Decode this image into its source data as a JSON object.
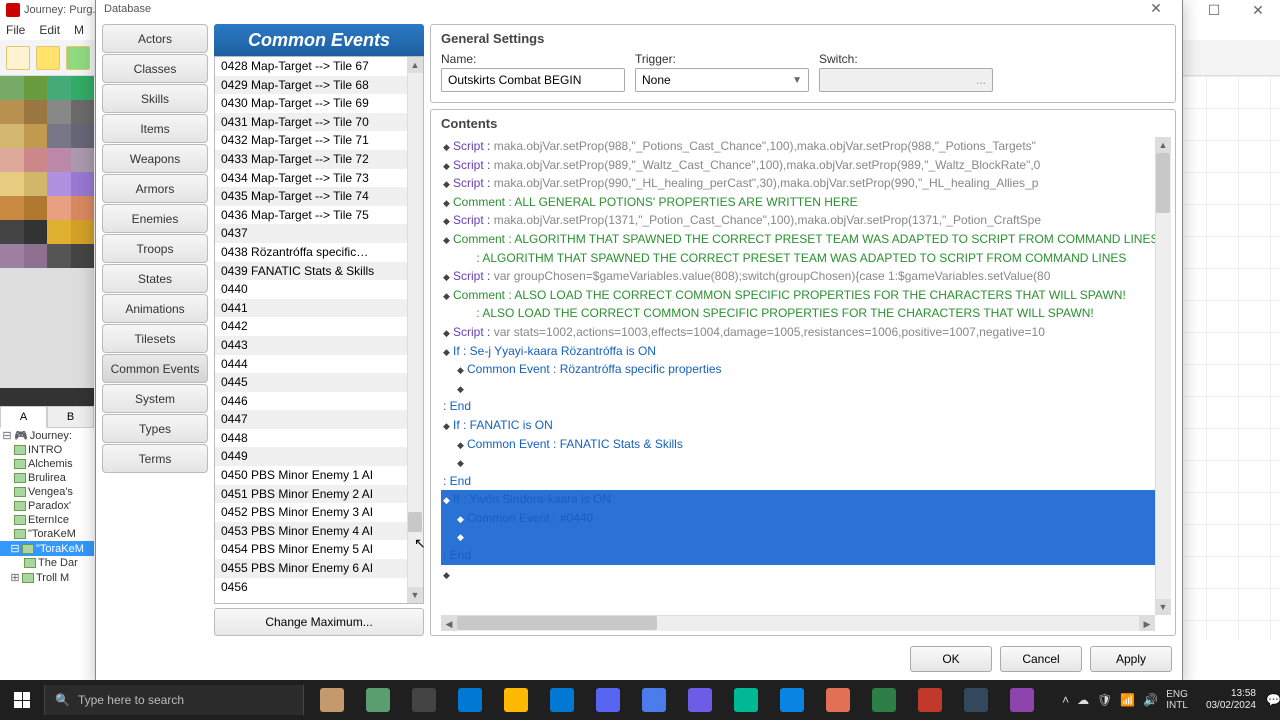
{
  "mainWindow": {
    "title": "Journey: Purg..."
  },
  "menubar": [
    "File",
    "Edit",
    "M"
  ],
  "layerTabs": {
    "a": "A",
    "b": "B"
  },
  "mapTree": {
    "root": "Journey:",
    "items": [
      "INTRO",
      "Alchemis",
      "Brulirea",
      "Vengea's",
      "Paradox'",
      "EternIce",
      "\"ToraKeM",
      "\"ToraKeM",
      "The Dar",
      "Troll M"
    ]
  },
  "dialog": {
    "title": "Database",
    "categories": [
      "Actors",
      "Classes",
      "Skills",
      "Items",
      "Weapons",
      "Armors",
      "Enemies",
      "Troops",
      "States",
      "Animations",
      "Tilesets",
      "Common Events",
      "System",
      "Types",
      "Terms"
    ],
    "activeCategory": "Common Events",
    "listHeader": "Common Events",
    "changeMax": "Change Maximum...",
    "list": [
      "0428 Map-Target --> Tile 67",
      "0429 Map-Target --> Tile 68",
      "0430 Map-Target --> Tile 69",
      "0431 Map-Target --> Tile 70",
      "0432 Map-Target --> Tile 71",
      "0433 Map-Target --> Tile 72",
      "0434 Map-Target --> Tile 73",
      "0435 Map-Target --> Tile 74",
      "0436 Map-Target --> Tile 75",
      "0437",
      "0438 Rözantróffa specific…",
      "0439 FANATIC Stats & Skills",
      "0440",
      "0441",
      "0442",
      "0443",
      "0444",
      "0445",
      "0446",
      "0447",
      "0448",
      "0449",
      "0450 PBS Minor Enemy 1 AI",
      "0451 PBS Minor Enemy 2 AI",
      "0452 PBS Minor Enemy 3 AI",
      "0453 PBS Minor Enemy 4 AI",
      "0454 PBS Minor Enemy 5 AI",
      "0455 PBS Minor Enemy 6 AI",
      "0456"
    ],
    "generalSettings": {
      "title": "General Settings",
      "nameLabel": "Name:",
      "nameValue": "Outskirts Combat BEGIN",
      "triggerLabel": "Trigger:",
      "triggerValue": "None",
      "switchLabel": "Switch:",
      "switchValue": "..."
    },
    "contentsTitle": "Contents",
    "code": [
      {
        "t": "script",
        "pl": "maka.objVar.setProp(988,\"_Potions_Cast_Chance\",100),maka.objVar.setProp(988,\"_Potions_Targets\""
      },
      {
        "t": "script",
        "pl": "maka.objVar.setProp(989,\"_Waltz_Cast_Chance\",100),maka.objVar.setProp(989,\"_Waltz_BlockRate\",0"
      },
      {
        "t": "script",
        "pl": "maka.objVar.setProp(990,\"_HL_healing_perCast\",30),maka.objVar.setProp(990,\"_HL_healing_Allies_p"
      },
      {
        "t": "comment",
        "pl": "ALL GENERAL POTIONS' PROPERTIES ARE WRITTEN HERE"
      },
      {
        "t": "script",
        "pl": "maka.objVar.setProp(1371,\"_Potion_Cast_Chance\",100),maka.objVar.setProp(1371,\"_Potion_CraftSpe"
      },
      {
        "t": "comment",
        "pl": "   ALGORITHM THAT SPAWNED THE CORRECT PRESET TEAM WAS ADAPTED TO SCRIPT FROM COMMAND LINES"
      },
      {
        "t": "cont",
        "pl": "   ALGORITHM THAT SPAWNED THE CORRECT PRESET TEAM WAS ADAPTED TO SCRIPT FROM COMMAND LINES"
      },
      {
        "t": "script",
        "pl": "var groupChosen=$gameVariables.value(808);switch(groupChosen){case 1:$gameVariables.setValue(80"
      },
      {
        "t": "comment",
        "pl": "   ALSO LOAD THE CORRECT COMMON SPECIFIC PROPERTIES FOR THE CHARACTERS THAT WILL SPAWN!"
      },
      {
        "t": "cont",
        "pl": "   ALSO LOAD THE CORRECT COMMON SPECIFIC PROPERTIES FOR THE CHARACTERS THAT WILL SPAWN!"
      },
      {
        "t": "script",
        "pl": "var stats=1002,actions=1003,effects=1004,damage=1005,resistances=1006,positive=1007,negative=10"
      },
      {
        "t": "if",
        "pl": "Se-j Yyayi-kaara Rözantróffa is ON"
      },
      {
        "t": "ce",
        "ind": 1,
        "pl": "Rözantróffa specific properties"
      },
      {
        "t": "blank",
        "ind": 1
      },
      {
        "t": "end"
      },
      {
        "t": "if",
        "pl": "FANATIC is ON"
      },
      {
        "t": "ce",
        "ind": 1,
        "pl": "FANATIC Stats & Skills"
      },
      {
        "t": "blank",
        "ind": 1
      },
      {
        "t": "end"
      },
      {
        "t": "if",
        "pl": "Yivón Sindora-kaara is ON",
        "sel": true
      },
      {
        "t": "ce",
        "ind": 1,
        "pl": "#0440",
        "sel": true
      },
      {
        "t": "blank",
        "ind": 1,
        "sel": true
      },
      {
        "t": "end",
        "sel": true
      },
      {
        "t": "blank"
      }
    ],
    "buttons": {
      "ok": "OK",
      "cancel": "Cancel",
      "apply": "Apply"
    }
  },
  "taskbar": {
    "searchPlaceholder": "Type here to search",
    "lang": "ENG",
    "kbd": "INTL",
    "time": "13:58",
    "date": "03/02/2024"
  }
}
